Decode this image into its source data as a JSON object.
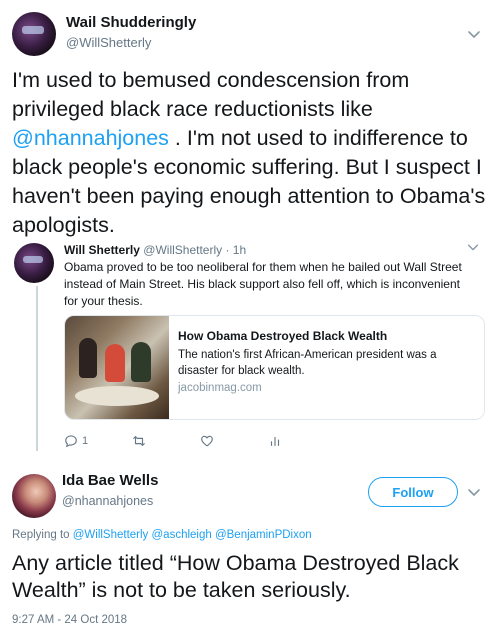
{
  "tweet": {
    "author_name": "Wail Shudderingly",
    "author_handle": "@WillShetterly",
    "text_before": "I'm used to bemused condescension from privileged black race reductionists like ",
    "mention": "@nhannahjones",
    "text_after": " . I'm not used to indifference to black people's economic suffering. But I suspect I haven't been paying enough attention to Obama's apologists.",
    "menu_icon": "chevron-down-icon"
  },
  "quoted": {
    "author_name": "Will Shetterly",
    "author_handle": "@WillShetterly · 1h",
    "text": "Obama proved to be too neoliberal for them when he bailed out Wall Street instead of Main Street. His black support also fell off, which is inconvenient for your thesis.",
    "card": {
      "title": "How Obama Destroyed Black Wealth",
      "description": "The nation's first African-American president was a disaster for black wealth.",
      "domain": "jacobinmag.com"
    },
    "actions": {
      "reply_count": "1",
      "icons": [
        "reply-icon",
        "retweet-icon",
        "like-icon",
        "analytics-icon"
      ]
    }
  },
  "reply": {
    "author_name": "Ida Bae Wells",
    "author_handle": "@nhannahjones",
    "follow_label": "Follow",
    "replying_prefix": "Replying to ",
    "replying_to": "@WillShetterly @aschleigh @BenjaminPDixon",
    "text": "Any article titled “How Obama Destroyed Black Wealth” is not to be taken seriously.",
    "timestamp": "9:27 AM - 24 Oct 2018"
  },
  "colors": {
    "accent": "#1da1f2",
    "secondary_text": "#657786",
    "divider": "#e1e8ed"
  }
}
